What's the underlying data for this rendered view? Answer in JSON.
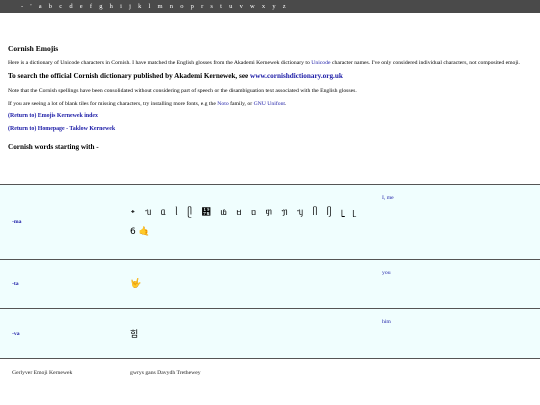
{
  "topnav": [
    "-",
    "'",
    "a",
    "b",
    "c",
    "d",
    "e",
    "f",
    "g",
    "h",
    "i",
    "j",
    "k",
    "l",
    "m",
    "n",
    "o",
    "p",
    "r",
    "s",
    "t",
    "u",
    "v",
    "w",
    "x",
    "y",
    "z"
  ],
  "page": {
    "title": "Cornish Emojis",
    "intro_before": "Here is a dictionary of Unicode characters in Cornish. I have matched the English glosses from the Akademi Kernewek dictionary to ",
    "intro_link": "Unicode",
    "intro_after": " character names. I've only considered individual characters, not composited emoji.",
    "search_text": "To search the official Cornish dictionary published by Akademi Kernewek, see ",
    "search_link": "www.cornishdictionary.org.uk",
    "note": "Note that the Cornish spellings have been consolidated without considering part of speech or the disambiguation text associated with the English glosses.",
    "blank_before": "If you are seeing a lot of blank tiles for missing characters, try installing more fonts, e.g the ",
    "blank_noto": "Noto",
    "blank_mid": " family, or ",
    "blank_gnu": "GNU Unifont",
    "blank_end": ".",
    "link_index": "(Return to) Emojis Kernewek index",
    "link_home": "(Return to) Homepage - Taklow Kernewek",
    "section_heading": "Cornish words starting with -"
  },
  "rows": [
    {
      "word": "-ma",
      "glyphs": "᛭ ᥔ ᥲ ᥣ ᥫ ᥵ ᥚ ᥛ ᥝ ᥞ ᥟ ᥡ ᥥ ᥦ ᥧ ᥨ",
      "emoji": "6 🤙",
      "gloss": "I, me"
    },
    {
      "word": "-ta",
      "emoji": "🤟",
      "gloss": "you"
    },
    {
      "word": "-va",
      "emoji": "힘",
      "gloss": "him"
    }
  ],
  "footer": {
    "left": "Gerlyver Emoji Kernewek",
    "right": "gwrys gans Davydh Trethewey"
  },
  "colors": {
    "link": "#1a1aa6",
    "row_bg": "#f0fefe",
    "nav_bg": "#4a4a4a"
  }
}
